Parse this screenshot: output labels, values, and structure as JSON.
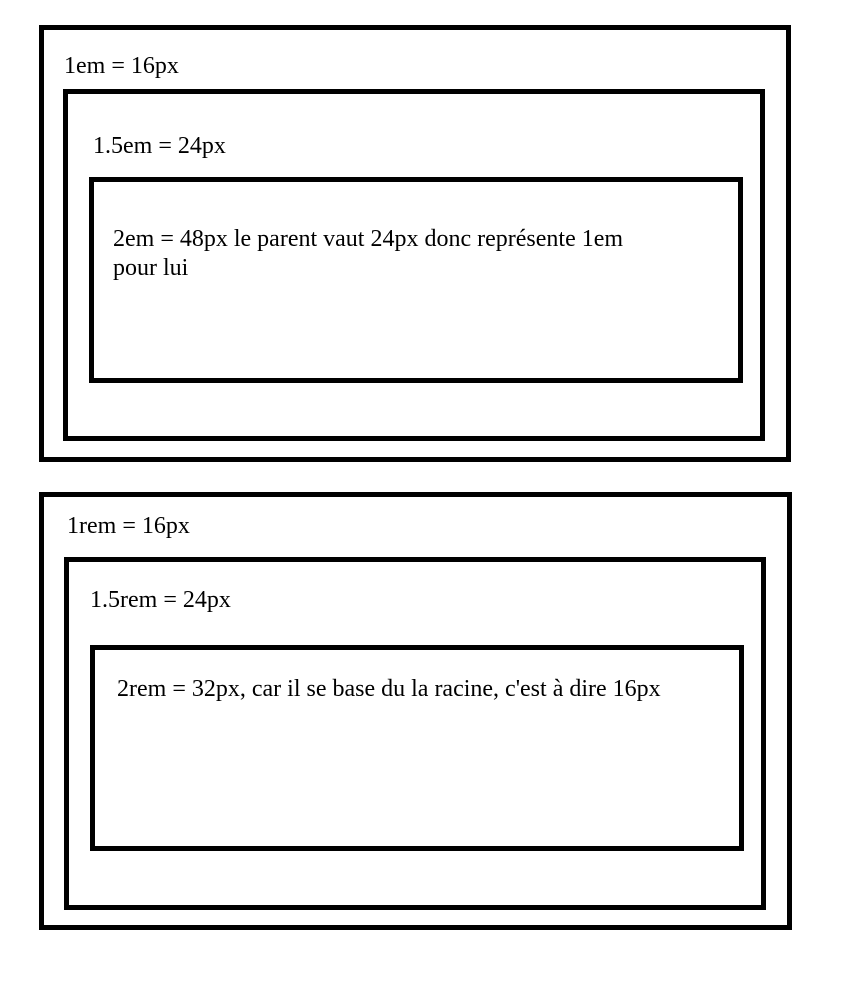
{
  "em_diagram": {
    "outer_label": "1em = 16px",
    "middle_label": "1.5em = 24px",
    "inner_label": "2em = 48px le parent vaut 24px donc représente 1em pour lui"
  },
  "rem_diagram": {
    "outer_label": "1rem = 16px",
    "middle_label": "1.5rem = 24px",
    "inner_label": "2rem = 32px, car il se base du la racine, c'est à dire 16px"
  },
  "colors": {
    "border": "#000000",
    "background": "#ffffff",
    "text": "#000000"
  }
}
